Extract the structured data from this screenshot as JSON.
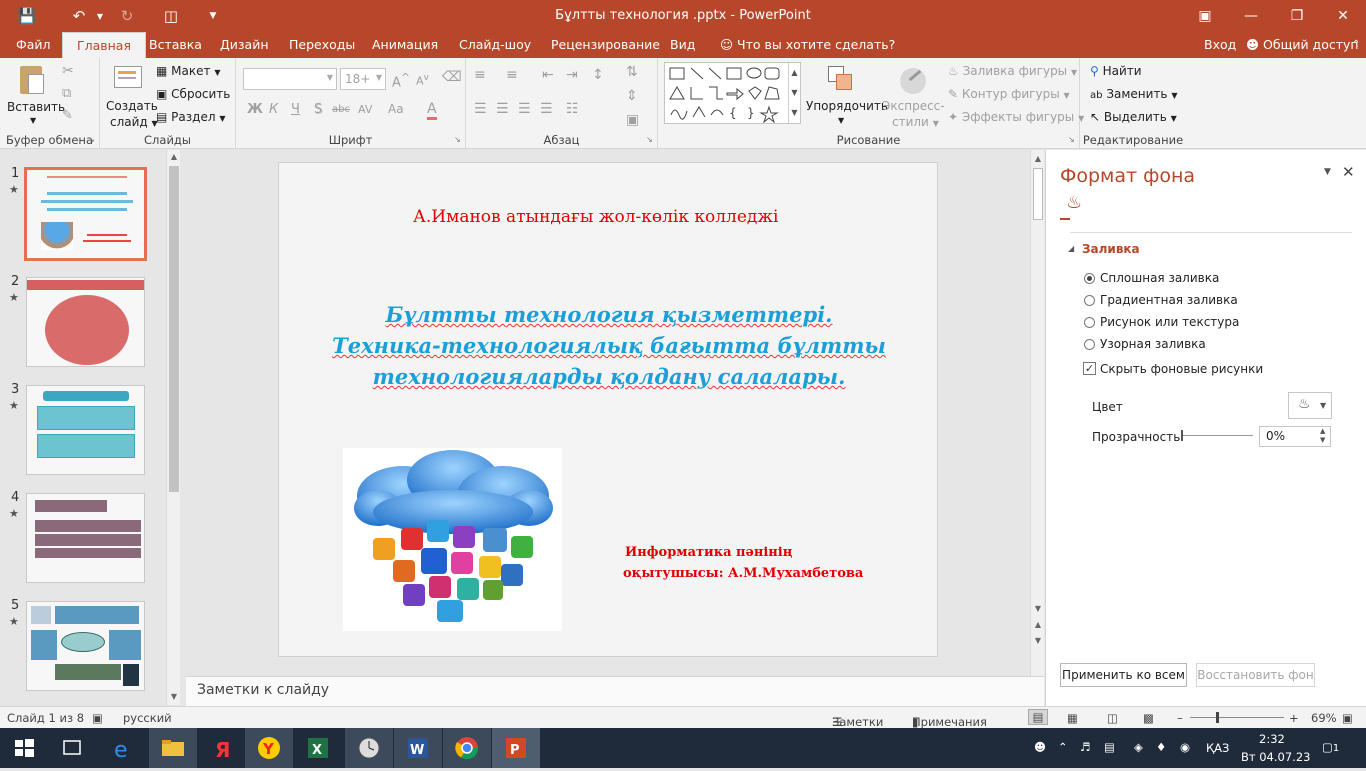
{
  "window": {
    "title": "Бұлтты технология .pptx - PowerPoint"
  },
  "quick_access": {
    "save_icon": "save-icon",
    "undo_icon": "undo-icon",
    "redo_icon": "redo-icon",
    "customize_icon": "customize-qat-icon"
  },
  "ribbon_tabs": {
    "file": "Файл",
    "home": "Главная",
    "insert": "Вставка",
    "design": "Дизайн",
    "transitions": "Переходы",
    "animation": "Анимация",
    "slideshow": "Слайд-шоу",
    "review": "Рецензирование",
    "view": "Вид",
    "tell_me": "Что вы хотите сделать?",
    "signin": "Вход",
    "share": "Общий доступ"
  },
  "ribbon": {
    "clipboard": {
      "paste": "Вставить",
      "group": "Буфер обмена"
    },
    "slides": {
      "new_slide": "Создать",
      "new_slide2": "слайд",
      "layout": "Макет",
      "reset": "Сбросить",
      "section": "Раздел",
      "group": "Слайды"
    },
    "font": {
      "font_size": "18+",
      "bold": "Ж",
      "italic": "К",
      "underline": "Ч",
      "shadow": "S",
      "strike": "abc",
      "spacing": "AV",
      "case": "Aa",
      "color": "A",
      "grow": "A",
      "shrink": "A",
      "group": "Шрифт"
    },
    "paragraph": {
      "group": "Абзац"
    },
    "drawing": {
      "arrange": "Упорядочить",
      "quick_styles": "Экспресс-",
      "quick_styles2": "стили",
      "shape_fill": "Заливка фигуры",
      "shape_outline": "Контур фигуры",
      "shape_effects": "Эффекты фигуры",
      "group": "Рисование"
    },
    "editing": {
      "find": "Найти",
      "replace": "Заменить",
      "select": "Выделить",
      "group": "Редактирование"
    }
  },
  "thumbnails": [
    {
      "num": "1",
      "star": "★"
    },
    {
      "num": "2",
      "star": "★"
    },
    {
      "num": "3",
      "star": "★"
    },
    {
      "num": "4",
      "star": "★"
    },
    {
      "num": "5",
      "star": "★"
    }
  ],
  "slide": {
    "college": "А.Иманов атындағы жол-көлік колледжі",
    "title_line1": "Бұлтты технология қызметтері.",
    "title_line2": "Техника-технологиялық бағытта бұлтты",
    "title_line3": "технологияларды қолдану салалары.",
    "author_line1": "Информатика пәнінің",
    "author_line2": "оқытушысы: А.М.Мухамбетова"
  },
  "notes": {
    "placeholder": "Заметки к слайду"
  },
  "format_pane": {
    "title": "Формат фона",
    "section": "Заливка",
    "options": [
      "Сплошная заливка",
      "Градиентная заливка",
      "Рисунок или текстура",
      "Узорная заливка"
    ],
    "selected": 0,
    "hide_bg": "Скрыть фоновые рисунки",
    "color_label": "Цвет",
    "transparency_label": "Прозрачность",
    "transparency_value": "0%",
    "apply_all": "Применить ко всем",
    "reset_bg": "Восстановить фон"
  },
  "status": {
    "slide_of": "Слайд 1 из 8",
    "language": "русский",
    "notes": "Заметки",
    "comments": "Примечания",
    "zoom": "69%"
  },
  "taskbar": {
    "lang": "ҚАЗ",
    "time": "2:32",
    "date": "Вт 04.07.23",
    "notif": "1"
  },
  "colors": {
    "accent": "#b7472a",
    "slide_red": "#e00000",
    "slide_blue": "#1a9fd8"
  }
}
